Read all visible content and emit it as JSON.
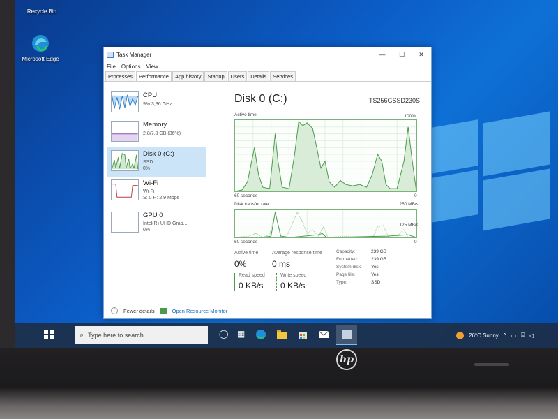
{
  "desktop": {
    "icons": [
      {
        "label": "Recycle Bin",
        "icon": "recycle-bin-icon"
      },
      {
        "label": "Microsoft Edge",
        "icon": "edge-icon"
      }
    ]
  },
  "task_manager": {
    "title": "Task Manager",
    "menu": [
      "File",
      "Options",
      "View"
    ],
    "tabs": [
      "Processes",
      "Performance",
      "App history",
      "Startup",
      "Users",
      "Details",
      "Services"
    ],
    "active_tab": "Performance",
    "sidebar": [
      {
        "name": "CPU",
        "sub1": "9% 3,36 GHz",
        "sub2": ""
      },
      {
        "name": "Memory",
        "sub1": "2,8/7,8 GB (36%)",
        "sub2": ""
      },
      {
        "name": "Disk 0 (C:)",
        "sub1": "SSD",
        "sub2": "0%"
      },
      {
        "name": "Wi-Fi",
        "sub1": "Wi-Fi",
        "sub2": "S: 0 R: 2,9 Mbps"
      },
      {
        "name": "GPU 0",
        "sub1": "Intel(R) UHD Grap...",
        "sub2": "0%"
      }
    ],
    "selected": "Disk 0 (C:)",
    "main": {
      "title": "Disk 0 (C:)",
      "model": "TS256GSSD230S",
      "active_time_label": "Active time",
      "active_time_max": "100%",
      "seconds_label": "60 seconds",
      "zero": "0",
      "transfer_label": "Disk transfer rate",
      "transfer_max": "250 MB/s",
      "transfer_mid": "125 MB/s",
      "stats": {
        "active_time_label": "Active time",
        "active_time_value": "0%",
        "avg_response_label": "Average response time",
        "avg_response_value": "0 ms",
        "read_label": "Read speed",
        "read_value": "0 KB/s",
        "write_label": "Write speed",
        "write_value": "0 KB/s"
      },
      "properties": [
        {
          "k": "Capacity:",
          "v": "239 GB"
        },
        {
          "k": "Formatted:",
          "v": "239 GB"
        },
        {
          "k": "System disk:",
          "v": "Yes"
        },
        {
          "k": "Page file:",
          "v": "Yes"
        },
        {
          "k": "Type:",
          "v": "SSD"
        }
      ]
    },
    "footer": {
      "fewer": "Fewer details",
      "link": "Open Resource Monitor"
    }
  },
  "taskbar": {
    "search_placeholder": "Type here to search",
    "weather": "26°C  Sunny",
    "pinned": [
      "task-view-icon",
      "widgets-icon",
      "edge-icon",
      "file-explorer-icon",
      "store-icon",
      "mail-icon",
      "task-manager-icon"
    ]
  },
  "colors": {
    "graph_line": "#4a9a4a",
    "graph_fill": "#d8ecd8",
    "selected": "#cce4f7",
    "link": "#1a6fc0"
  }
}
